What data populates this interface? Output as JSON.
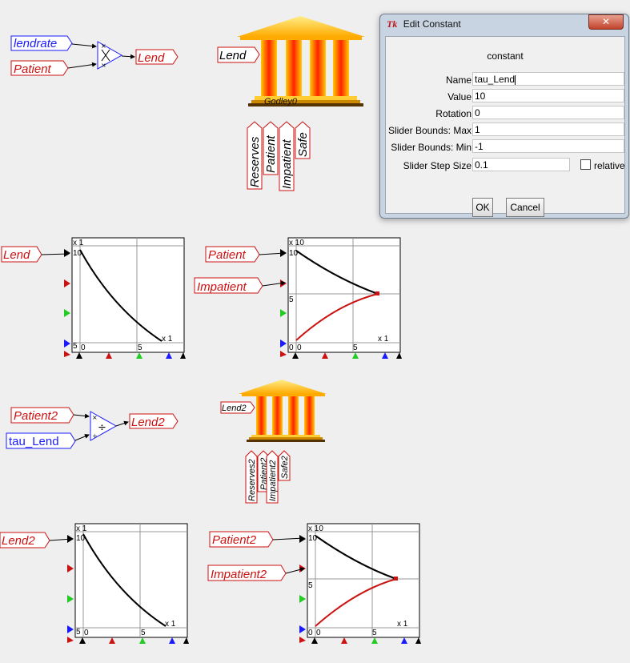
{
  "canvas": {
    "top_mult": {
      "inputs": [
        "lendrate",
        "Patient"
      ],
      "output": "Lend"
    },
    "godley1": {
      "name": "Godley0",
      "input": "Lend",
      "columns": [
        "Reserves",
        "Patient",
        "Impatient",
        "Safe"
      ]
    },
    "plot1": {
      "inputs": [
        "Lend"
      ],
      "ylabel_top": "x 1",
      "ymax": "10",
      "ymin": "5",
      "xmin": "0",
      "xmid": "5",
      "xscale": "x 1"
    },
    "plot2": {
      "inputs": [
        "Patient",
        "Impatient"
      ],
      "ylabel_top": "x 10",
      "ymax": "10",
      "ymid": "5",
      "ymin": "0",
      "xmin": "0",
      "xmid": "5",
      "xscale": "x 1"
    },
    "div_block": {
      "inputs": [
        "Patient2",
        "tau_Lend"
      ],
      "output": "Lend2"
    },
    "godley2": {
      "input": "Lend2",
      "columns": [
        "Reserves2",
        "Patient2",
        "Impatient2",
        "Safe2"
      ]
    },
    "plot3": {
      "inputs": [
        "Lend2"
      ],
      "ylabel_top": "x 1",
      "ymax": "10",
      "ymin": "5",
      "xmin": "0",
      "xmid": "5",
      "xscale": "x 1"
    },
    "plot4": {
      "inputs": [
        "Patient2",
        "Impatient2"
      ],
      "ylabel_top": "x 10",
      "ymax": "10",
      "ymid": "5",
      "ymin": "0",
      "xmin": "0",
      "xmid": "5",
      "xscale": "x 1"
    }
  },
  "dialog": {
    "icon": "tk-feather-icon",
    "title": "Edit Constant",
    "close": "✕",
    "heading": "constant",
    "fields": [
      {
        "label": "Name",
        "value": "tau_Lend"
      },
      {
        "label": "Value",
        "value": "10"
      },
      {
        "label": "Rotation",
        "value": "0"
      },
      {
        "label": "Slider Bounds: Max",
        "value": "1"
      },
      {
        "label": "Slider Bounds: Min",
        "value": "-1"
      },
      {
        "label": "Slider Step Size",
        "value": "0.1"
      }
    ],
    "relative_label": "relative",
    "relative_checked": false,
    "ok": "OK",
    "cancel": "Cancel"
  },
  "colors": {
    "blue": "#1a1aff",
    "red": "#cc1111",
    "green": "#22cc22",
    "dialog_frame": "#c8d4e2"
  }
}
